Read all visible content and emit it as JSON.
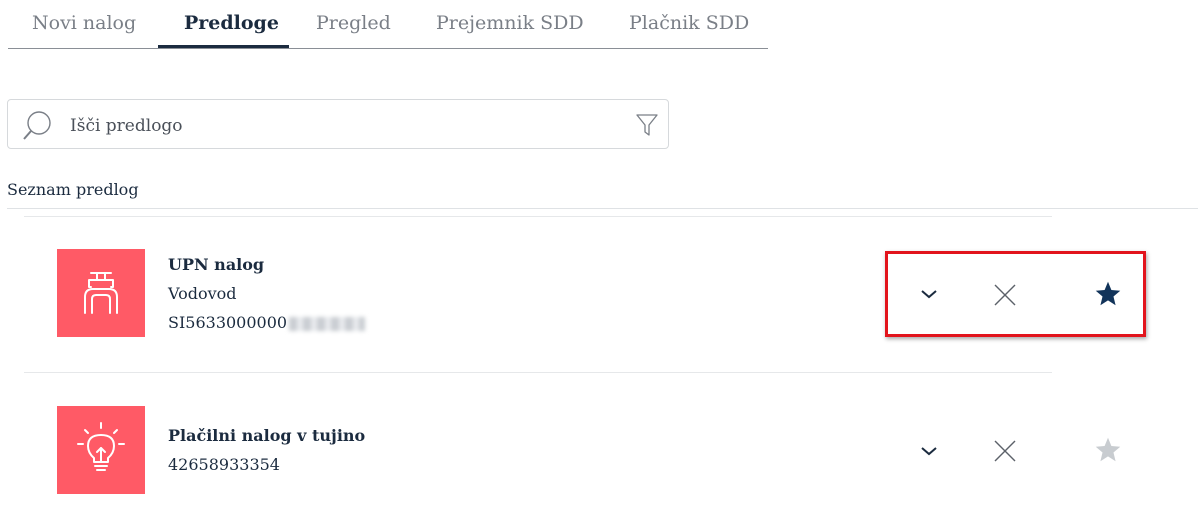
{
  "tabs": [
    {
      "label": "Novi nalog",
      "active": false
    },
    {
      "label": "Predloge",
      "active": true
    },
    {
      "label": "Pregled",
      "active": false
    },
    {
      "label": "Prejemnik SDD",
      "active": false
    },
    {
      "label": "Plačnik SDD",
      "active": false
    }
  ],
  "search": {
    "placeholder": "Išči predlogo"
  },
  "section_title": "Seznam predlog",
  "templates": [
    {
      "icon": "faucet-icon",
      "title": "UPN nalog",
      "subtitle": "Vodovod",
      "account": "SI5633000000",
      "favorite": true
    },
    {
      "icon": "lightbulb-icon",
      "title": "Plačilni nalog v tujino",
      "account": "42658933354",
      "favorite": false
    }
  ],
  "colors": {
    "accent_tile": "#ff5a66",
    "primary_text": "#1b2b3f",
    "highlight": "#e2141c",
    "star_inactive": "#c8ccd0"
  }
}
